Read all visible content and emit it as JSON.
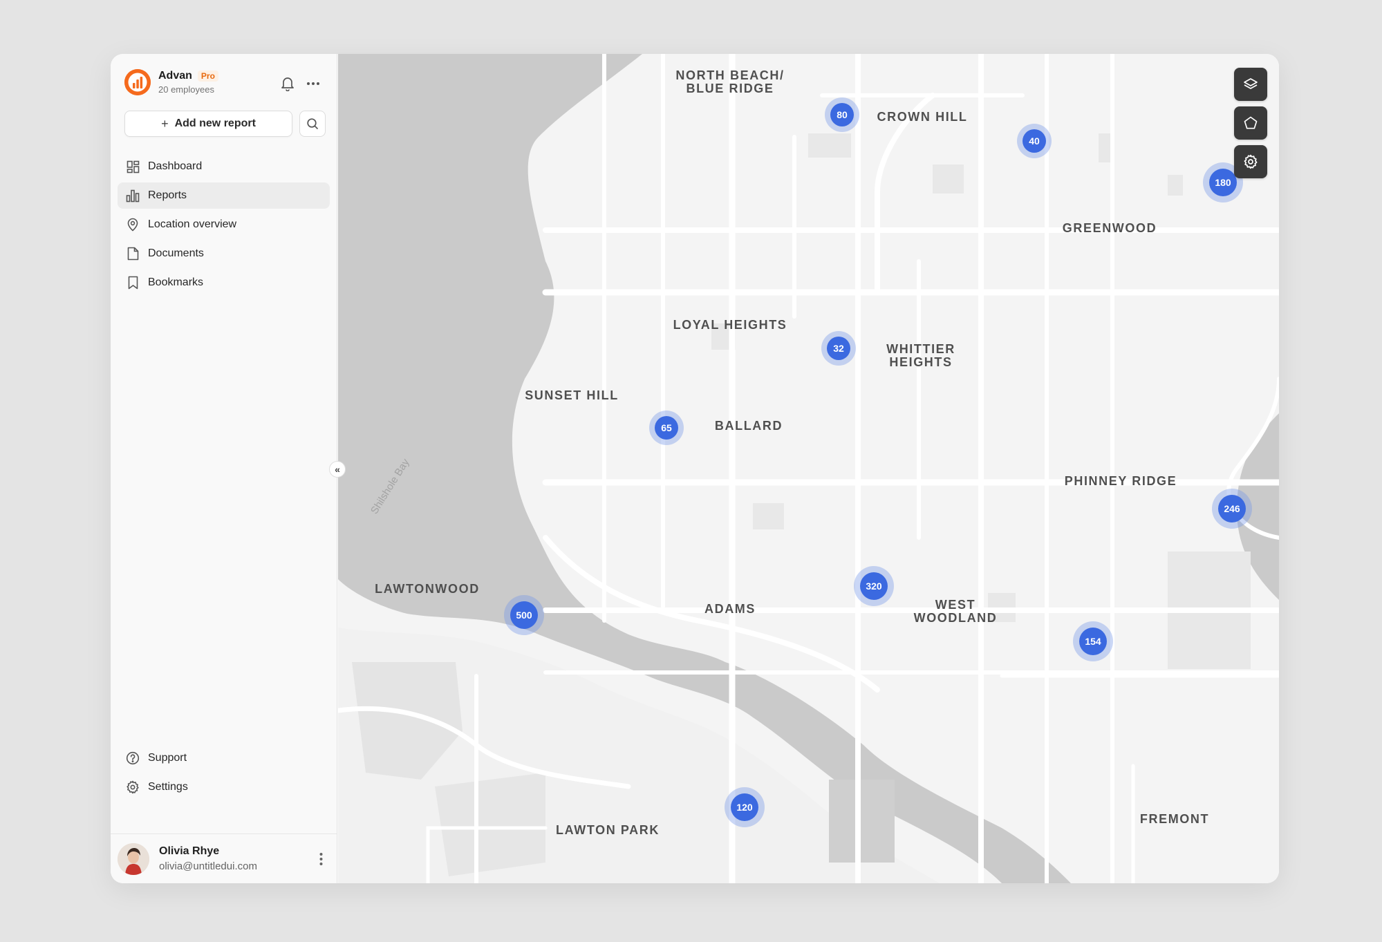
{
  "brand": {
    "name": "Advan",
    "badge": "Pro",
    "subtitle": "20 employees",
    "logo_color": "#f56a1d"
  },
  "actions": {
    "add_report_label": "Add new report"
  },
  "nav": [
    {
      "label": "Dashboard",
      "icon": "dashboard-icon",
      "active": false
    },
    {
      "label": "Reports",
      "icon": "bar-chart-icon",
      "active": true
    },
    {
      "label": "Location overview",
      "icon": "location-pin-icon",
      "active": false
    },
    {
      "label": "Documents",
      "icon": "document-icon",
      "active": false
    },
    {
      "label": "Bookmarks",
      "icon": "bookmark-icon",
      "active": false
    }
  ],
  "bottom_nav": [
    {
      "label": "Support",
      "icon": "help-circle-icon"
    },
    {
      "label": "Settings",
      "icon": "gear-icon"
    }
  ],
  "user": {
    "name": "Olivia Rhye",
    "email": "olivia@untitledui.com"
  },
  "map": {
    "water_label": "Shilshole Bay",
    "areas": [
      {
        "key": "north-beach",
        "label": "NORTH BEACH/\nBLUE RIDGE"
      },
      {
        "key": "crown-hill",
        "label": "CROWN HILL"
      },
      {
        "key": "greenwood",
        "label": "GREENWOOD"
      },
      {
        "key": "loyal-heights",
        "label": "LOYAL HEIGHTS"
      },
      {
        "key": "whittier-heights",
        "label": "WHITTIER\nHEIGHTS"
      },
      {
        "key": "sunset-hill",
        "label": "SUNSET HILL"
      },
      {
        "key": "ballard",
        "label": "BALLARD"
      },
      {
        "key": "phinney-ridge",
        "label": "PHINNEY RIDGE"
      },
      {
        "key": "lawtonwood",
        "label": "LAWTONWOOD"
      },
      {
        "key": "adams",
        "label": "ADAMS"
      },
      {
        "key": "west-woodland",
        "label": "WEST\nWOODLAND"
      },
      {
        "key": "lawton-park",
        "label": "LAWTON PARK"
      },
      {
        "key": "fremont",
        "label": "FREMONT"
      }
    ],
    "clusters": [
      {
        "key": "north-beach",
        "count": "80"
      },
      {
        "key": "crown-hill",
        "count": "40"
      },
      {
        "key": "greenwood",
        "count": "180"
      },
      {
        "key": "loyal-heights",
        "count": "32"
      },
      {
        "key": "sunset-hill",
        "count": "65"
      },
      {
        "key": "phinney-ridge",
        "count": "246"
      },
      {
        "key": "adams",
        "count": "320"
      },
      {
        "key": "lawtonwood",
        "count": "500"
      },
      {
        "key": "west-woodland",
        "count": "154"
      },
      {
        "key": "lawton-park",
        "count": "120"
      }
    ],
    "cluster_color": "#3b69e0",
    "tools": [
      {
        "name": "layers-icon"
      },
      {
        "name": "polygon-icon"
      },
      {
        "name": "map-settings-icon"
      }
    ]
  }
}
